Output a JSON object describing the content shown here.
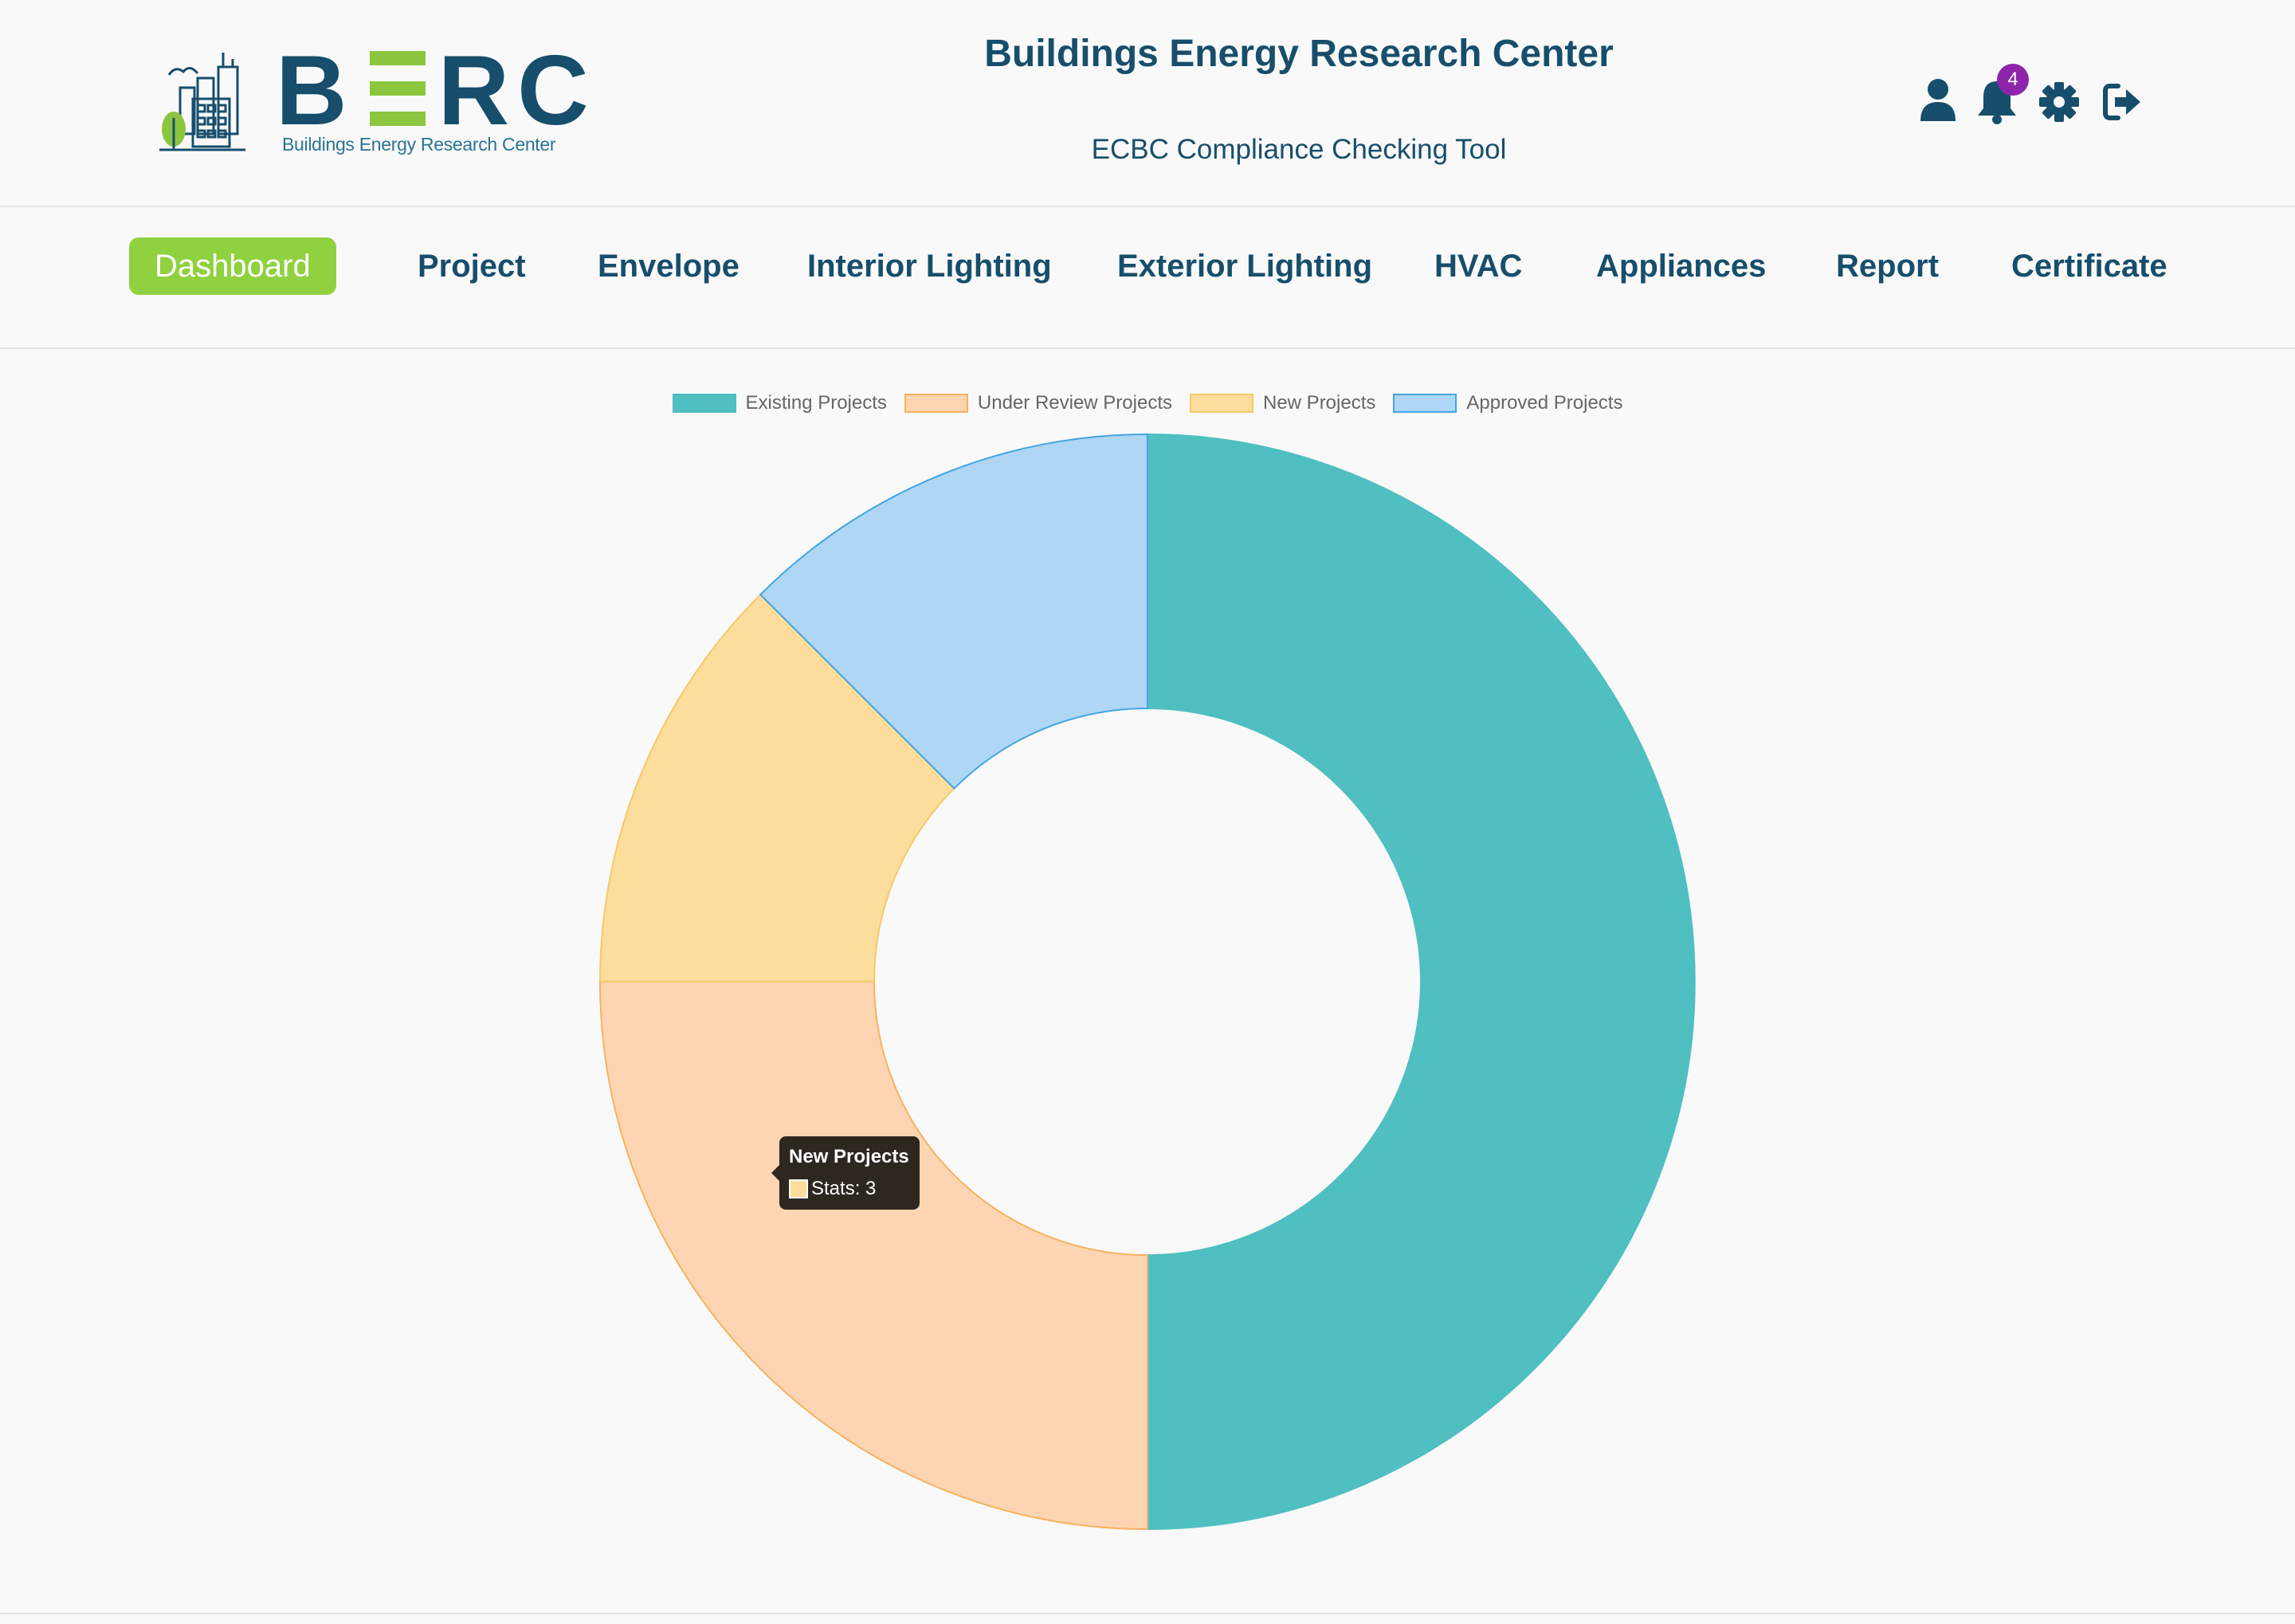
{
  "brand": {
    "logo_letters": [
      "B",
      "E",
      "R",
      "C"
    ],
    "logo_subtitle": "Buildings Energy Research Center",
    "title": "Buildings Energy Research Center",
    "subtitle": "ECBC Compliance Checking Tool"
  },
  "header_icons": {
    "user": "user-icon",
    "notifications": "bell-icon",
    "notification_count": "4",
    "settings": "gear-icon",
    "logout": "sign-out-icon"
  },
  "nav": {
    "items": [
      {
        "label": "Dashboard",
        "active": true
      },
      {
        "label": "Project"
      },
      {
        "label": "Envelope"
      },
      {
        "label": "Interior Lighting"
      },
      {
        "label": "Exterior Lighting"
      },
      {
        "label": "HVAC"
      },
      {
        "label": "Appliances"
      },
      {
        "label": "Report"
      },
      {
        "label": "Certificate"
      }
    ]
  },
  "colors": {
    "primary": "#174e6c",
    "accent": "#8fd13f",
    "badge": "#8e24aa"
  },
  "chart_data": {
    "type": "pie",
    "variant": "doughnut",
    "labels": [
      "Existing Projects",
      "Under Review Projects",
      "New Projects",
      "Approved Projects"
    ],
    "values": [
      12,
      6,
      3,
      3
    ],
    "colors": [
      "#4fbfc1",
      "#fdd5b2",
      "#fddd9c",
      "#b0d6f5"
    ],
    "border_colors": [
      "#4fbfc1",
      "#f7b260",
      "#f5c96a",
      "#43a5e0"
    ],
    "legend_position": "top",
    "tooltip": {
      "title": "New Projects",
      "label": "Stats: 3"
    }
  }
}
